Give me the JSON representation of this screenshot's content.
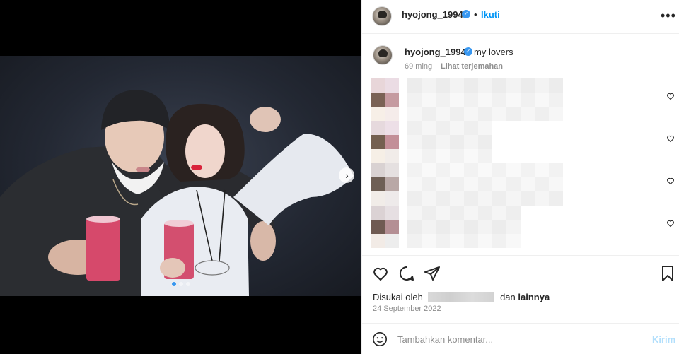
{
  "post": {
    "username": "hyojong_1994",
    "follow_label": "Ikuti",
    "dot_separator": "•",
    "more_label": "•••",
    "caption": "my lovers",
    "age": "69 ming",
    "translate_label": "Lihat terjemahan",
    "likes_prefix": "Disukai oleh",
    "likes_suffix_and": "dan",
    "likes_suffix_others": "lainnya",
    "date": "24 September 2022",
    "comment_placeholder": "Tambahkan komentar...",
    "send_label": "Kirim",
    "carousel": {
      "count": 3,
      "active": 0
    }
  },
  "comments": [
    {
      "swatches": [
        "#e8d6d9",
        "#ebdce4",
        "#7a6255",
        "#c59aa0",
        "#f7efe7",
        "#f5ecea"
      ]
    },
    {
      "swatches": [
        "#e6d9dd",
        "#eddfe7",
        "#746050",
        "#c38f98",
        "#f6efe6",
        "#f1ece9"
      ]
    },
    {
      "swatches": [
        "#d9d2d2",
        "#e5e0e0",
        "#6e5f55",
        "#b9a8a6",
        "#f1ece8",
        "#eeeaea"
      ]
    },
    {
      "swatches": [
        "#dbd2d4",
        "#e6dfe2",
        "#6f5a52",
        "#b48f94",
        "#f2ebe6",
        "#ededed"
      ]
    }
  ],
  "colors": {
    "accent": "#0095f6",
    "verified": "#3897f0",
    "send_disabled": "#b2dffc"
  }
}
